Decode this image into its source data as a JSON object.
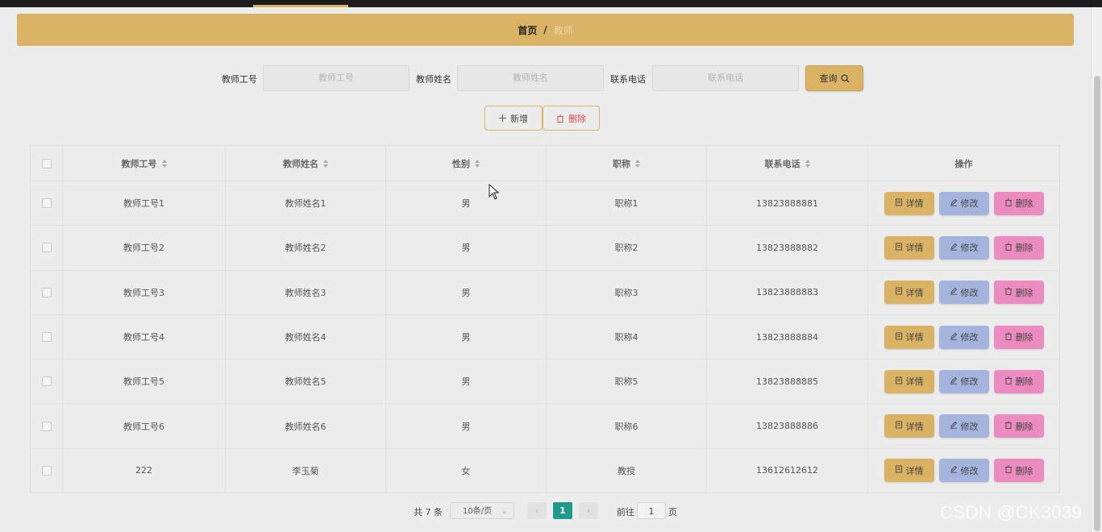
{
  "breadcrumb": {
    "home": "首页",
    "separator": "/",
    "current": "教师"
  },
  "search": {
    "fields": [
      {
        "label": "教师工号",
        "placeholder": "教师工号"
      },
      {
        "label": "教师姓名",
        "placeholder": "教师姓名"
      },
      {
        "label": "联系电话",
        "placeholder": "联系电话"
      }
    ],
    "query_label": "查询",
    "query_icon": "search-icon"
  },
  "actions": {
    "add_label": "新增",
    "add_icon": "plus-icon",
    "delete_label": "删除",
    "delete_icon": "trash-icon"
  },
  "table": {
    "columns": [
      "教师工号",
      "教师姓名",
      "性别",
      "职称",
      "联系电话",
      "操作"
    ],
    "rows": [
      [
        "教师工号1",
        "教师姓名1",
        "男",
        "职称1",
        "13823888881"
      ],
      [
        "教师工号2",
        "教师姓名2",
        "男",
        "职称2",
        "13823888882"
      ],
      [
        "教师工号3",
        "教师姓名3",
        "男",
        "职称3",
        "13823888883"
      ],
      [
        "教师工号4",
        "教师姓名4",
        "男",
        "职称4",
        "13823888884"
      ],
      [
        "教师工号5",
        "教师姓名5",
        "男",
        "职称5",
        "13823888885"
      ],
      [
        "教师工号6",
        "教师姓名6",
        "男",
        "职称6",
        "13823888886"
      ],
      [
        "222",
        "李玉菊",
        "女",
        "教授",
        "13612612612"
      ]
    ],
    "row_actions": {
      "detail": "详情",
      "edit": "修改",
      "delete": "删除"
    }
  },
  "pagination": {
    "total_text": "共 7 条",
    "page_size": "10条/页",
    "current_page": "1",
    "goto_label": "前往",
    "goto_value": "1",
    "page_suffix": "页"
  },
  "watermark": "CSDN @CK3039",
  "colors": {
    "accent": "#d9b264",
    "edit": "#a4b4dc",
    "delete": "#ec8bbf",
    "pager_active": "#1f9a8a"
  }
}
